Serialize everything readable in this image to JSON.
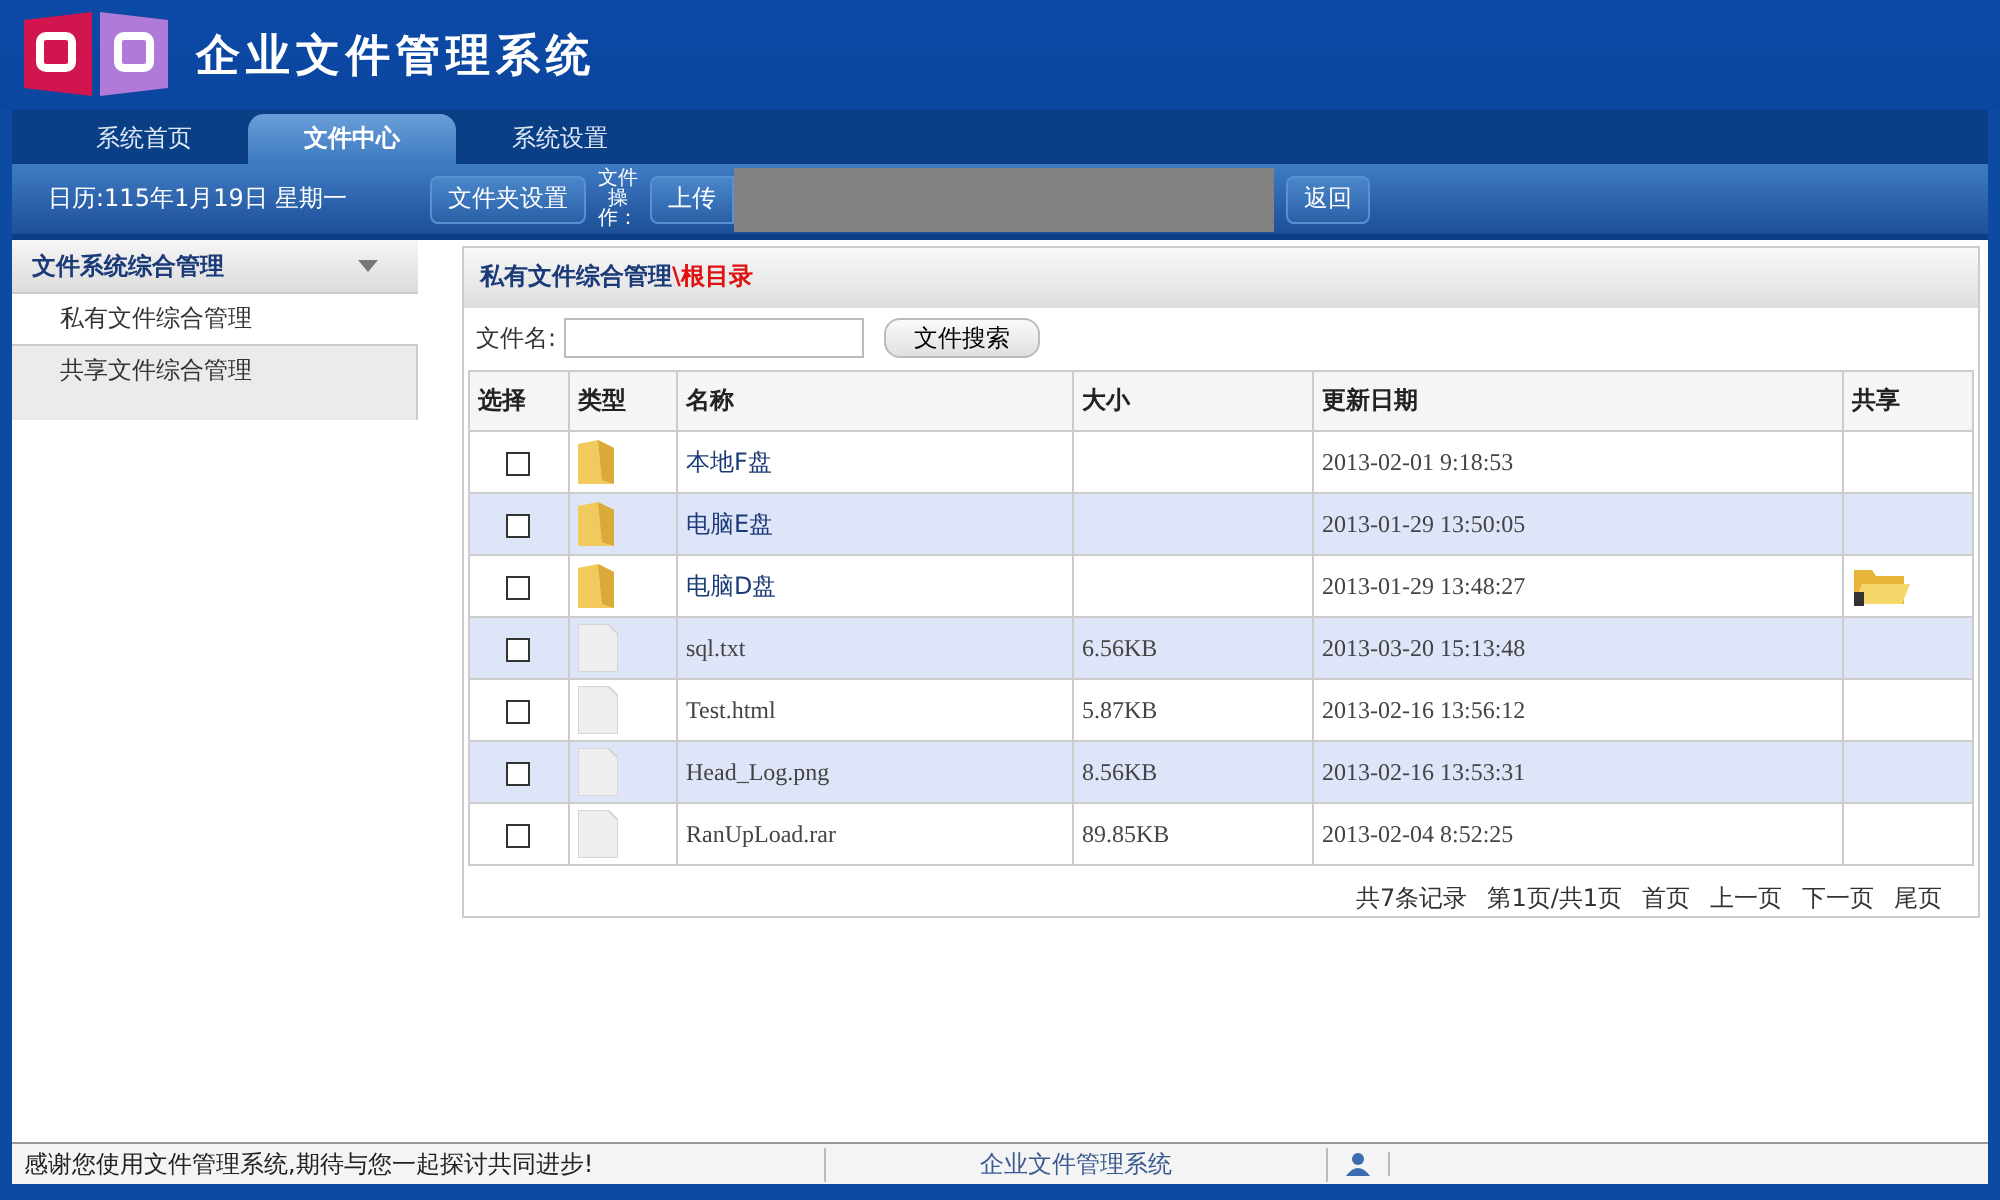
{
  "app": {
    "title": "企业文件管理系统"
  },
  "tabs": [
    {
      "label": "系统首页",
      "selected": false
    },
    {
      "label": "文件中心",
      "selected": true
    },
    {
      "label": "系统设置",
      "selected": false
    }
  ],
  "toolbar": {
    "date": "日历:115年1月19日 星期一",
    "folder_button": "文件夹设置",
    "ops_label": "文件操作：",
    "upload_button": "上传",
    "back_button": "返回"
  },
  "sidebar": {
    "title": "文件系统综合管理",
    "expanded": true,
    "items": [
      {
        "label": "私有文件综合管理",
        "selected": true
      },
      {
        "label": "共享文件综合管理",
        "selected": false
      }
    ]
  },
  "panel": {
    "title": "私有文件综合管理",
    "path": "\\根目录"
  },
  "search": {
    "label": "文件名:",
    "button": "文件搜索"
  },
  "table": {
    "columns": [
      "选择",
      "类型",
      "名称",
      "大小",
      "更新日期",
      "共享"
    ],
    "rows": [
      {
        "kind": "folder",
        "checked": false,
        "name": "本地F盘",
        "size": "",
        "date": "2013-02-01 9:18:53",
        "shared": false
      },
      {
        "kind": "folder",
        "checked": false,
        "name": "电脑E盘",
        "size": "",
        "date": "2013-01-29 13:50:05",
        "shared": false
      },
      {
        "kind": "folder",
        "checked": false,
        "name": "电脑D盘",
        "size": "",
        "date": "2013-01-29 13:48:27",
        "shared": true
      },
      {
        "kind": "file",
        "checked": false,
        "name": "sql.txt",
        "size": "6.56KB",
        "date": "2013-03-20 15:13:48",
        "shared": false
      },
      {
        "kind": "file",
        "checked": false,
        "name": "Test.html",
        "size": "5.87KB",
        "date": "2013-02-16 13:56:12",
        "shared": false
      },
      {
        "kind": "file",
        "checked": false,
        "name": "Head_Log.png",
        "size": "8.56KB",
        "date": "2013-02-16 13:53:31",
        "shared": false
      },
      {
        "kind": "file",
        "checked": false,
        "name": "RanUpLoad.rar",
        "size": "89.85KB",
        "date": "2013-02-04 8:52:25",
        "shared": false
      }
    ]
  },
  "pager": {
    "total": "共7条记录",
    "page": "第1页/共1页",
    "links": [
      "首页",
      "上一页",
      "下一页",
      "尾页"
    ]
  },
  "footer": {
    "message": "感谢您使用文件管理系统,期待与您一起探讨共同进步!",
    "title": "企业文件管理系统"
  }
}
